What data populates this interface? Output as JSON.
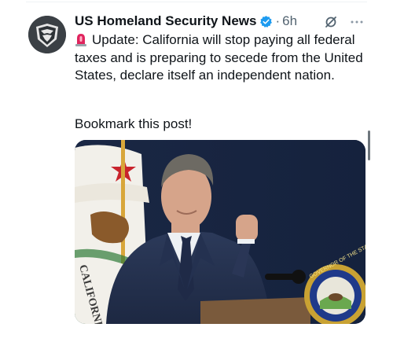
{
  "account": {
    "name": "US Homeland Security News",
    "verified": true,
    "separator": "·",
    "time": "6h"
  },
  "icons": {
    "avatar": "shield-eagle-logo",
    "verified": "verified-badge-icon",
    "grok": "grok-icon",
    "more": "more-icon",
    "siren": "police-light-emoji"
  },
  "tweet": {
    "text": "Update: California will stop paying all federal taxes and is preparing to secede from the United States, declare itself an independent nation.",
    "bookmark": "Bookmark this post!"
  },
  "media": {
    "description_seal_text": "GOVERNOR OF THE STATE OF CALIFORNIA",
    "flag_text": "CALIFORNIA RE"
  },
  "colors": {
    "verified_blue": "#1d9bf0",
    "muted": "#536471",
    "text": "#0f1419"
  }
}
